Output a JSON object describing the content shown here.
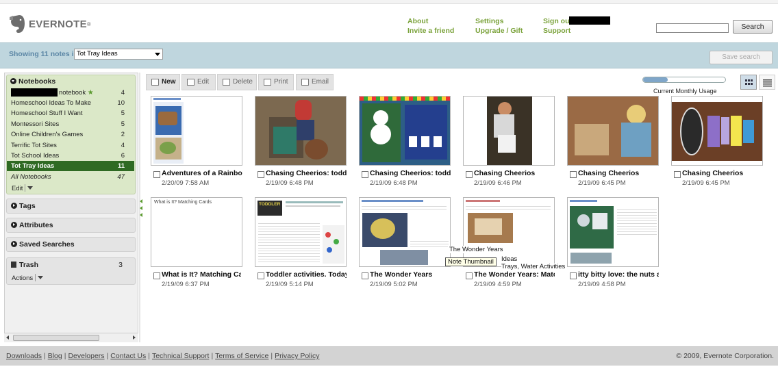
{
  "header": {
    "logo_text": "EVERNOTE",
    "links": {
      "about": "About",
      "invite": "Invite a friend",
      "settings": "Settings",
      "upgrade": "Upgrade / Gift",
      "signout": "Sign out",
      "support": "Support"
    },
    "search_placeholder": "",
    "search_button": "Search"
  },
  "filter": {
    "showing_prefix": "Showing",
    "note_count": "11",
    "showing_suffix": "notes in",
    "selected_notebook": "Tot Tray Ideas",
    "save_search": "Save search"
  },
  "sidebar": {
    "notebooks_title": "Notebooks",
    "notebooks": [
      {
        "name": "notebook",
        "count": "4",
        "redacted": true,
        "default": true
      },
      {
        "name": "Homeschool Ideas To Make",
        "count": "10"
      },
      {
        "name": "Homeschool Stuff I Want",
        "count": "5"
      },
      {
        "name": "Montessori Sites",
        "count": "5"
      },
      {
        "name": "Online Children's Games",
        "count": "2"
      },
      {
        "name": "Terrific Tot Sites",
        "count": "4"
      },
      {
        "name": "Tot School Ideas",
        "count": "6"
      },
      {
        "name": "Tot Tray Ideas",
        "count": "11",
        "selected": true
      },
      {
        "name": "All Notebooks",
        "count": "47"
      }
    ],
    "edit_label": "Edit",
    "tags_title": "Tags",
    "attributes_title": "Attributes",
    "saved_searches_title": "Saved Searches",
    "trash_title": "Trash",
    "trash_count": "3",
    "actions_label": "Actions"
  },
  "toolbar": {
    "new": "New",
    "edit": "Edit",
    "delete": "Delete",
    "print": "Print",
    "email": "Email",
    "usage_label": "Current Monthly Usage",
    "usage_fraction": 0.3
  },
  "notes": [
    {
      "title": "Adventures of a Rainbow",
      "date": "2/20/09 7:58 AM"
    },
    {
      "title": "Chasing Cheerios: toddle",
      "date": "2/19/09 6:48 PM"
    },
    {
      "title": "Chasing Cheerios: toddle",
      "date": "2/19/09 6:48 PM"
    },
    {
      "title": "Chasing Cheerios",
      "date": "2/19/09 6:46 PM"
    },
    {
      "title": "Chasing Cheerios",
      "date": "2/19/09 6:45 PM"
    },
    {
      "title": "Chasing Cheerios",
      "date": "2/19/09 6:45 PM"
    },
    {
      "title": "What is It? Matching Car",
      "date": "2/19/09 6:37 PM",
      "thumb_text": "What is It? Matching Cards"
    },
    {
      "title": "Toddler activities. Today'",
      "date": "2/19/09 5:14 PM",
      "thumb_logo": "TODDLER"
    },
    {
      "title": "The Wonder Years",
      "date": "2/19/09 5:02 PM"
    },
    {
      "title": "The Wonder Years: Matc",
      "date": "2/19/09 4:59 PM"
    },
    {
      "title": "itty bitty love: the nuts an",
      "date": "2/19/09 4:58 PM"
    }
  ],
  "tooltip": {
    "line1": "The Wonder Years",
    "label": "Note Thumbnail",
    "fragment1": "Ideas",
    "fragment2": "Trays, Water Activities"
  },
  "footer": {
    "links": [
      "Downloads",
      "Blog",
      "Developers",
      "Contact Us",
      "Technical Support",
      "Terms of Service",
      "Privacy Policy"
    ],
    "copyright": "© 2009, Evernote Corporation."
  }
}
